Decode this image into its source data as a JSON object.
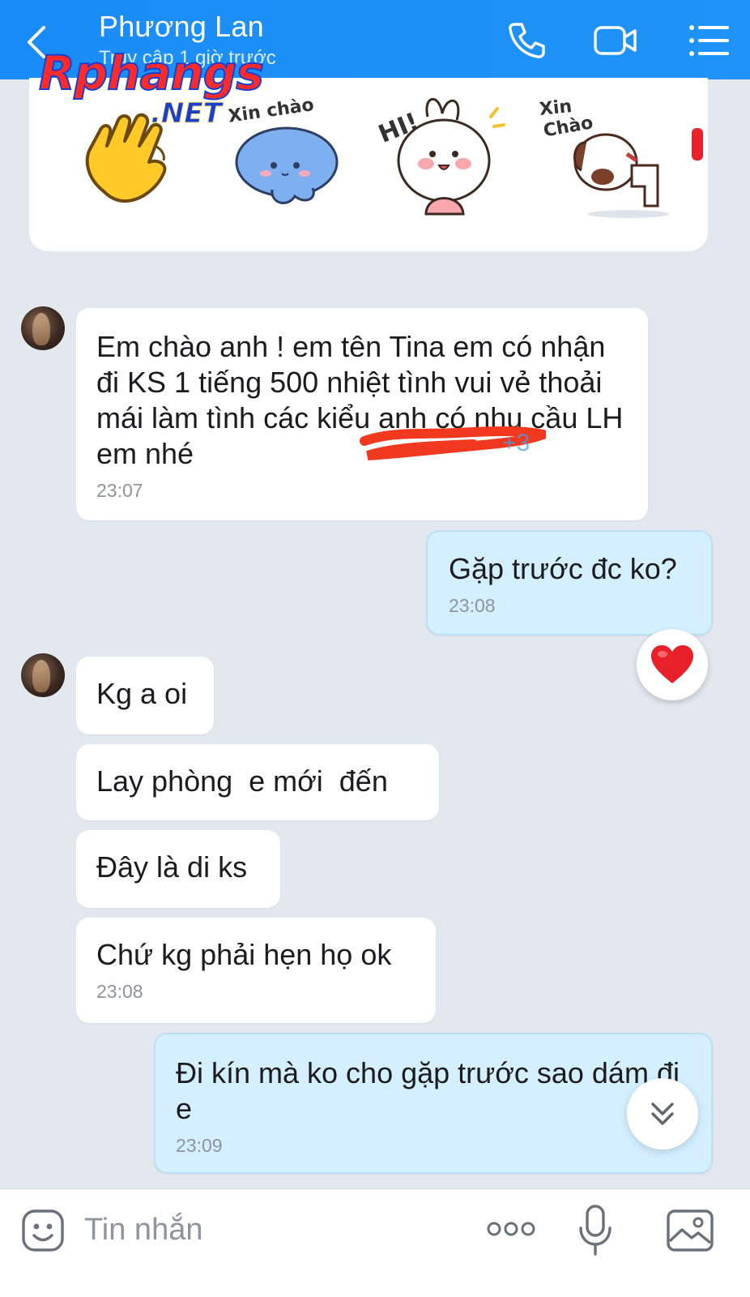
{
  "header": {
    "contact_name": "Phương Lan",
    "status": "Truy cập 1 giờ trước"
  },
  "watermark": {
    "main": "Rphangs",
    "suffix": ".NET"
  },
  "sticker_panel": {
    "stickers": [
      {
        "icon": "waving-hand-sticker"
      },
      {
        "icon": "xin-chao-cat-sticker",
        "label": "Xin chào"
      },
      {
        "icon": "hi-bunny-sticker",
        "label": "HI!"
      },
      {
        "icon": "xin-chao-dog-sticker",
        "label": "Xin\nChào"
      }
    ]
  },
  "messages": [
    {
      "direction": "incoming",
      "text": "Em chào anh ! em tên Tina em có nhận đi KS 1 tiếng 500 nhiệt tình vui vẻ thoải mái làm tình các kiểu anh có nhu cầu LH em nhé",
      "time": "23:07"
    },
    {
      "direction": "outgoing",
      "text": "Gặp trước đc ko?",
      "time": "23:08",
      "reaction": "heart"
    },
    {
      "direction": "incoming",
      "text": "Kg a oi"
    },
    {
      "direction": "incoming",
      "text": "Lay phòng  e mới  đến"
    },
    {
      "direction": "incoming",
      "text": "Đây là di ks"
    },
    {
      "direction": "incoming",
      "text": "Chứ kg phải hẹn họ ok",
      "time": "23:08"
    },
    {
      "direction": "outgoing",
      "text": "Đi kín mà ko cho gặp trước sao dám đi e",
      "time": "23:09"
    }
  ],
  "input_bar": {
    "placeholder": "Tin nhắn"
  },
  "colors": {
    "header_bg": "#1a8cf7",
    "chat_bg": "#e3e8ef",
    "outgoing_bubble": "#d4efff",
    "incoming_bubble": "#ffffff",
    "reaction_heart": "#e8202a"
  }
}
